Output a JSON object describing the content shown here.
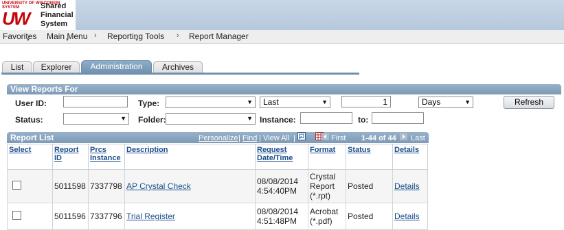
{
  "header": {
    "logo_top": "UNIVERSITY OF WISCONSIN SYSTEM",
    "logo_mark": "UW",
    "app_name_line1": "Shared",
    "app_name_line2": "Financial",
    "app_name_line3": "System"
  },
  "nav": {
    "favorites": "Favorites",
    "main_menu": "Main Menu",
    "sep": "›",
    "reporting_tools": "Reporting Tools",
    "report_manager": "Report Manager",
    "dropdown_glyph": "▼"
  },
  "tabs": [
    {
      "label": "List"
    },
    {
      "label": "Explorer"
    },
    {
      "label": "Administration",
      "active": true
    },
    {
      "label": "Archives"
    }
  ],
  "filters": {
    "title": "View Reports For",
    "user_id_label": "User ID:",
    "user_id_value": "",
    "type_label": "Type:",
    "type_value": "",
    "last_value": "Last",
    "number_value": "1",
    "days_value": "Days",
    "refresh_label": "Refresh",
    "status_label": "Status:",
    "status_value": "",
    "folder_label": "Folder:",
    "folder_value": "",
    "instance_label": "Instance:",
    "instance_value": "",
    "to_label": "to:",
    "to_value": "",
    "dropdown_glyph": "▼"
  },
  "report_list": {
    "title": "Report List",
    "personalize": "Personalize",
    "find": "Find",
    "view_all": "View All",
    "first": "First",
    "range": "1-44 of 44",
    "last": "Last",
    "separator": "|",
    "icons": [
      "zoom-icon",
      "grid-download-icon",
      "first-arrow-icon",
      "last-arrow-icon"
    ],
    "columns": [
      "Select",
      "Report ID",
      "Prcs Instance",
      "Description",
      "Request Date/Time",
      "Format",
      "Status",
      "Details"
    ],
    "rows": [
      {
        "report_id": "5011598",
        "prcs_instance": "7337798",
        "description": "AP Crystal Check",
        "request_date": "08/08/2014",
        "request_time": "4:54:40PM",
        "format_line1": "Crystal",
        "format_line2": "Report",
        "format_line3": "(*.rpt)",
        "status": "Posted",
        "details": "Details"
      },
      {
        "report_id": "5011596",
        "prcs_instance": "7337796",
        "description": "Trial Register",
        "request_date": "08/08/2014",
        "request_time": "4:51:48PM",
        "format_line1": "Acrobat",
        "format_line2": "(*.pdf)",
        "format_line3": "",
        "status": "Posted",
        "details": "Details"
      }
    ]
  },
  "colors": {
    "accent": "#6f91b0",
    "link": "#1b4f8c",
    "brand_red": "#c5050c"
  }
}
